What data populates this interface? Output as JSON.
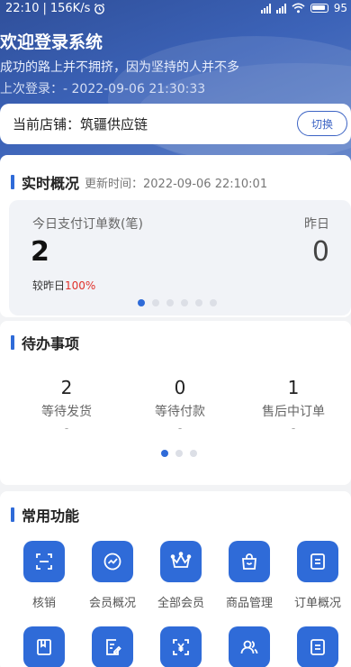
{
  "status_bar": {
    "time": "22:10",
    "speed": "156K/s",
    "battery": "95"
  },
  "header": {
    "welcome": "欢迎登录系统",
    "slogan": "成功的路上并不拥挤，因为坚持的人并不多",
    "last_login": "上次登录：- 2022-09-06 21:30:33"
  },
  "store": {
    "label": "当前店铺：筑疆供应链",
    "switch_label": "切换"
  },
  "realtime": {
    "title": "实时概况",
    "update_time": "更新时间：2022-09-06 22:10:01",
    "today_label": "今日支付订单数(笔)",
    "today_value": "2",
    "yesterday_label": "昨日",
    "yesterday_value": "0",
    "compare_prefix": "较昨日",
    "compare_value": "100%",
    "page_count": 6,
    "active_page": 0
  },
  "todo": {
    "title": "待办事项",
    "items": [
      {
        "count": "2",
        "label": "等待发货",
        "dash": "-"
      },
      {
        "count": "0",
        "label": "等待付款",
        "dash": "-"
      },
      {
        "count": "1",
        "label": "售后中订单",
        "dash": "-"
      }
    ],
    "page_count": 3,
    "active_page": 0
  },
  "functions": {
    "title": "常用功能",
    "items": [
      {
        "label": "核销",
        "icon": "scan-icon"
      },
      {
        "label": "会员概况",
        "icon": "trend-icon"
      },
      {
        "label": "全部会员",
        "icon": "crown-icon"
      },
      {
        "label": "商品管理",
        "icon": "shopping-bag-icon"
      },
      {
        "label": "订单概况",
        "icon": "order-list-icon"
      },
      {
        "label": "",
        "icon": "book-icon"
      },
      {
        "label": "",
        "icon": "edit-doc-icon"
      },
      {
        "label": "",
        "icon": "yen-scan-icon"
      },
      {
        "label": "",
        "icon": "users-icon"
      },
      {
        "label": "",
        "icon": "document-icon"
      }
    ]
  },
  "colors": {
    "accent": "#2f6bd8",
    "header_bg": "#3c63b8",
    "highlight_red": "#e0302a"
  }
}
